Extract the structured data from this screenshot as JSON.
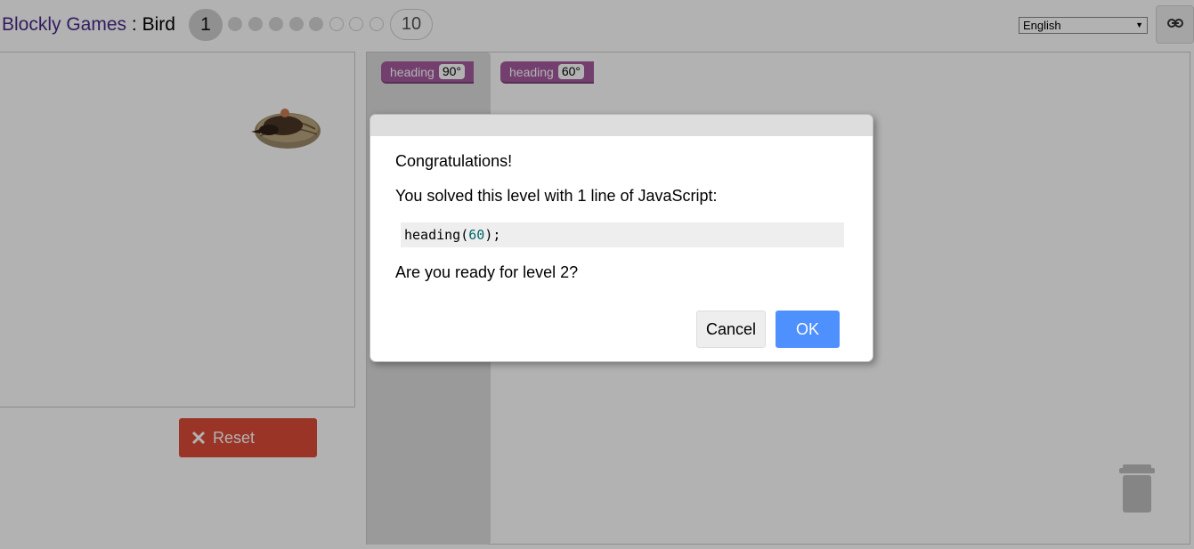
{
  "header": {
    "site_link": "Blockly Games",
    "separator": " : ",
    "game_name": "Bird",
    "current_level": "1",
    "last_level": "10",
    "language": "English",
    "link_icon": "link-icon"
  },
  "levels": {
    "completed": 5,
    "remaining": 3
  },
  "controls": {
    "reset_label": "Reset",
    "reset_icon": "close-icon",
    "reset_color": "#dd4b39"
  },
  "workspace": {
    "flyout_block": {
      "label": "heading",
      "value": "90°"
    },
    "workspace_block": {
      "label": "heading",
      "value": "60°"
    },
    "block_color": "#a55b9f",
    "trash_icon": "trash-icon"
  },
  "dialog": {
    "congrats": "Congratulations!",
    "solved_text": "You solved this level with 1 line of JavaScript:",
    "code": {
      "fn": "heading(",
      "arg": "60",
      "end": ");"
    },
    "ready_text": "Are you ready for level 2?",
    "cancel_label": "Cancel",
    "ok_label": "OK",
    "ok_color": "#4d90fe"
  }
}
